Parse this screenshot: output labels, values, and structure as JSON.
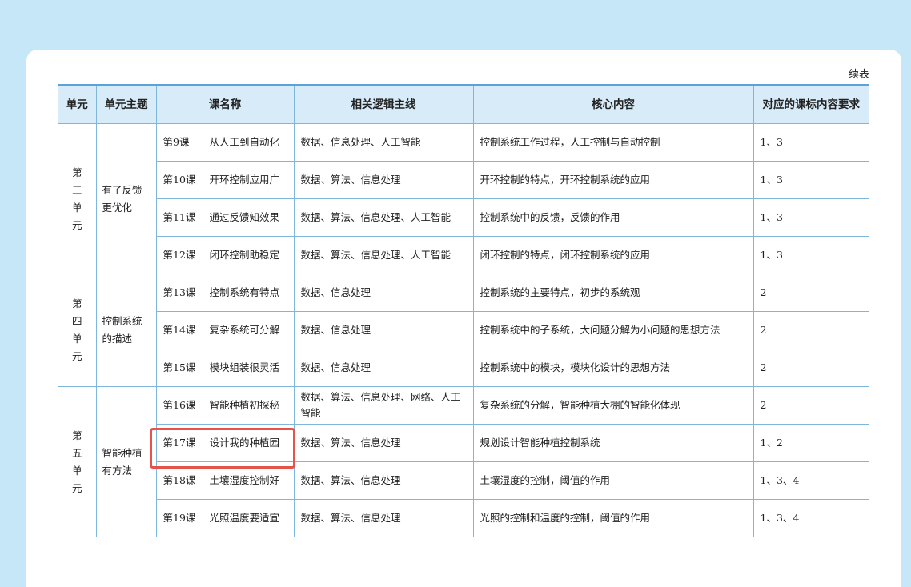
{
  "continued_label": "续表",
  "headers": [
    "单元",
    "单元主题",
    "课名称",
    "相关逻辑主线",
    "核心内容",
    "对应的课标内容要求"
  ],
  "units": [
    {
      "unit": [
        "第",
        "三",
        "单",
        "元"
      ],
      "theme": [
        "有了反馈",
        "更优化"
      ],
      "lessons": [
        {
          "num": "第9课",
          "name": "从人工到自动化",
          "logic": "数据、信息处理、人工智能",
          "core": "控制系统工作过程，人工控制与自动控制",
          "req": "1、3"
        },
        {
          "num": "第10课",
          "name": "开环控制应用广",
          "logic": "数据、算法、信息处理",
          "core": "开环控制的特点，开环控制系统的应用",
          "req": "1、3"
        },
        {
          "num": "第11课",
          "name": "通过反馈知效果",
          "logic": "数据、算法、信息处理、人工智能",
          "core": "控制系统中的反馈，反馈的作用",
          "req": "1、3"
        },
        {
          "num": "第12课",
          "name": "闭环控制助稳定",
          "logic": "数据、算法、信息处理、人工智能",
          "core": "闭环控制的特点，闭环控制系统的应用",
          "req": "1、3"
        }
      ]
    },
    {
      "unit": [
        "第",
        "四",
        "单",
        "元"
      ],
      "theme": [
        "控制系统",
        "的描述"
      ],
      "lessons": [
        {
          "num": "第13课",
          "name": "控制系统有特点",
          "logic": "数据、信息处理",
          "core": "控制系统的主要特点，初步的系统观",
          "req": "2"
        },
        {
          "num": "第14课",
          "name": "复杂系统可分解",
          "logic": "数据、信息处理",
          "core": "控制系统中的子系统，大问题分解为小问题的思想方法",
          "req": "2"
        },
        {
          "num": "第15课",
          "name": "模块组装很灵活",
          "logic": "数据、信息处理",
          "core": "控制系统中的模块，模块化设计的思想方法",
          "req": "2"
        }
      ]
    },
    {
      "unit": [
        "第",
        "五",
        "单",
        "元"
      ],
      "theme": [
        "智能种植",
        "有方法"
      ],
      "lessons": [
        {
          "num": "第16课",
          "name": "智能种植初探秘",
          "logic": "数据、算法、信息处理、网络、人工智能",
          "core": "复杂系统的分解，智能种植大棚的智能化体现",
          "req": "2"
        },
        {
          "num": "第17课",
          "name": "设计我的种植园",
          "logic": "数据、算法、信息处理",
          "core": "规划设计智能种植控制系统",
          "req": "1、2"
        },
        {
          "num": "第18课",
          "name": "土壤湿度控制好",
          "logic": "数据、算法、信息处理",
          "core": "土壤湿度的控制，阈值的作用",
          "req": "1、3、4"
        },
        {
          "num": "第19课",
          "name": "光照温度要适宜",
          "logic": "数据、算法、信息处理",
          "core": "光照的控制和温度的控制，阈值的作用",
          "req": "1、3、4"
        }
      ]
    }
  ]
}
